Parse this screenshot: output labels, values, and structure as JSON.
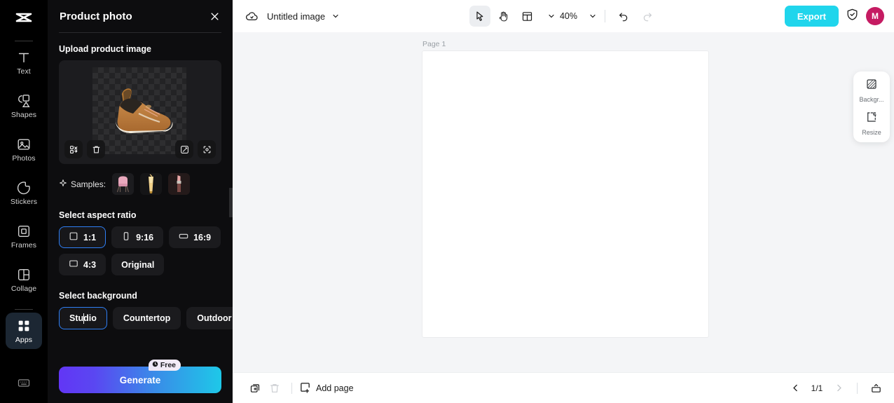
{
  "rail": {
    "logo_icon": "capcut-logo-icon",
    "items": [
      {
        "label": "Text",
        "icon": "text-icon",
        "active": false
      },
      {
        "label": "Shapes",
        "icon": "shapes-icon",
        "active": false
      },
      {
        "label": "Photos",
        "icon": "photos-icon",
        "active": false
      },
      {
        "label": "Stickers",
        "icon": "stickers-icon",
        "active": false
      },
      {
        "label": "Frames",
        "icon": "frames-icon",
        "active": false
      },
      {
        "label": "Collage",
        "icon": "collage-icon",
        "active": false
      },
      {
        "label": "Apps",
        "icon": "apps-grid-icon",
        "active": true
      }
    ],
    "bottom_icon": "keyboard-icon"
  },
  "panel": {
    "title": "Product photo",
    "close_icon": "close-icon",
    "upload": {
      "section_title": "Upload product image",
      "image_alt": "product-shoe-image",
      "buttons": [
        {
          "name": "crop-resize-icon"
        },
        {
          "name": "delete-icon"
        },
        {
          "name": "magic-edit-icon"
        },
        {
          "name": "expand-icon"
        }
      ]
    },
    "samples": {
      "label": "Samples:",
      "sparkle_icon": "sparkle-icon",
      "items": [
        {
          "name": "sample-chair",
          "colors": [
            "#e8a9bd",
            "#d18a9f",
            "#6d5a52"
          ]
        },
        {
          "name": "sample-drink",
          "colors": [
            "#f0d089",
            "#d9a94f",
            "#8a6a2d"
          ]
        },
        {
          "name": "sample-lipstick",
          "colors": [
            "#e8a6a6",
            "#b65a5a",
            "#3a2a2a"
          ]
        }
      ]
    },
    "aspect": {
      "section_title": "Select aspect ratio",
      "options": [
        {
          "label": "1:1",
          "shape": "square",
          "selected": true
        },
        {
          "label": "9:16",
          "shape": "portrait",
          "selected": false
        },
        {
          "label": "16:9",
          "shape": "landscape",
          "selected": false
        },
        {
          "label": "4:3",
          "shape": "square43",
          "selected": false
        },
        {
          "label": "Original",
          "shape": "none",
          "selected": false
        }
      ]
    },
    "background": {
      "section_title": "Select background",
      "options": [
        {
          "label": "Studio",
          "selected": true,
          "caret_after": 3
        },
        {
          "label": "Countertop",
          "selected": false
        },
        {
          "label": "Outdoor",
          "selected": false
        }
      ]
    },
    "generate": {
      "label": "Generate",
      "badge": "Free",
      "badge_icon": "clock-icon",
      "gradient_from": "#6236f5",
      "gradient_to": "#1ec8e8"
    },
    "collapse_handle_icon": "chevron-left-icon"
  },
  "topbar": {
    "cloud_icon": "cloud-saved-icon",
    "doc_name": "Untitled image",
    "doc_caret_icon": "chevron-down-icon",
    "tools": [
      {
        "name": "select-tool",
        "icon": "cursor-arrow-icon",
        "active": true
      },
      {
        "name": "hand-tool",
        "icon": "hand-icon",
        "active": false
      },
      {
        "name": "layout-tool",
        "icon": "layout-icon",
        "active": false
      }
    ],
    "layout_caret_icon": "chevron-down-icon",
    "zoom": "40%",
    "zoom_caret_icon": "chevron-down-icon",
    "undo_icon": "undo-icon",
    "redo_icon": "redo-icon",
    "export_label": "Export",
    "shield_icon": "shield-check-icon",
    "avatar_initial": "M",
    "avatar_color": "#c51b62"
  },
  "canvas": {
    "page_label": "Page 1"
  },
  "float_panel": {
    "items": [
      {
        "label": "Backgr...",
        "icon": "background-icon"
      },
      {
        "label": "Resize",
        "icon": "resize-icon"
      }
    ]
  },
  "bottombar": {
    "duplicate_icon": "duplicate-page-icon",
    "delete_icon": "delete-page-icon",
    "add_page_label": "Add page",
    "add_page_icon": "add-page-icon",
    "prev_icon": "chevron-left-icon",
    "page_indicator": "1/1",
    "next_icon": "chevron-right-icon",
    "pages_panel_icon": "pages-panel-icon"
  }
}
